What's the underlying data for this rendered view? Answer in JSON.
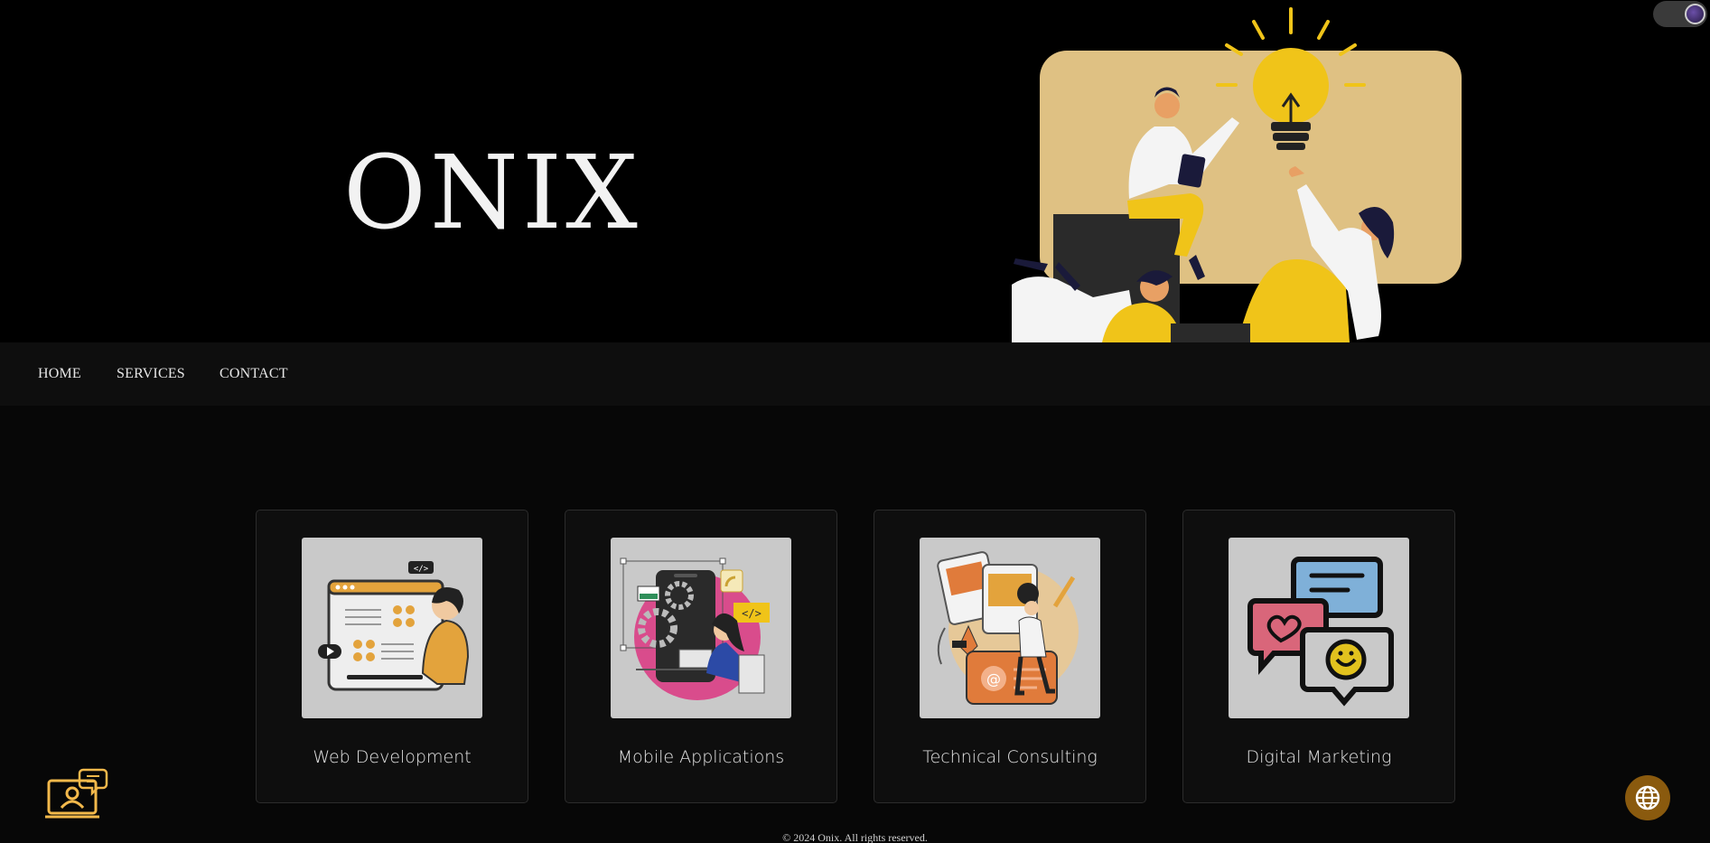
{
  "brand": {
    "name": "ONIX"
  },
  "nav": {
    "items": [
      {
        "label": "HOME"
      },
      {
        "label": "SERVICES"
      },
      {
        "label": "CONTACT"
      }
    ]
  },
  "services": [
    {
      "label": "Web Development",
      "icon": "web-development-illustration"
    },
    {
      "label": "Mobile Applications",
      "icon": "mobile-apps-illustration"
    },
    {
      "label": "Technical Consulting",
      "icon": "consulting-illustration"
    },
    {
      "label": "Digital Marketing",
      "icon": "marketing-chat-illustration"
    }
  ],
  "footer": {
    "copyright": "© 2024 Onix. All rights reserved."
  },
  "colors": {
    "accent": "#f0c419",
    "panel": "#dfc183",
    "globe_button": "#8a5a0e",
    "chat_icon": "#f2b84b"
  }
}
